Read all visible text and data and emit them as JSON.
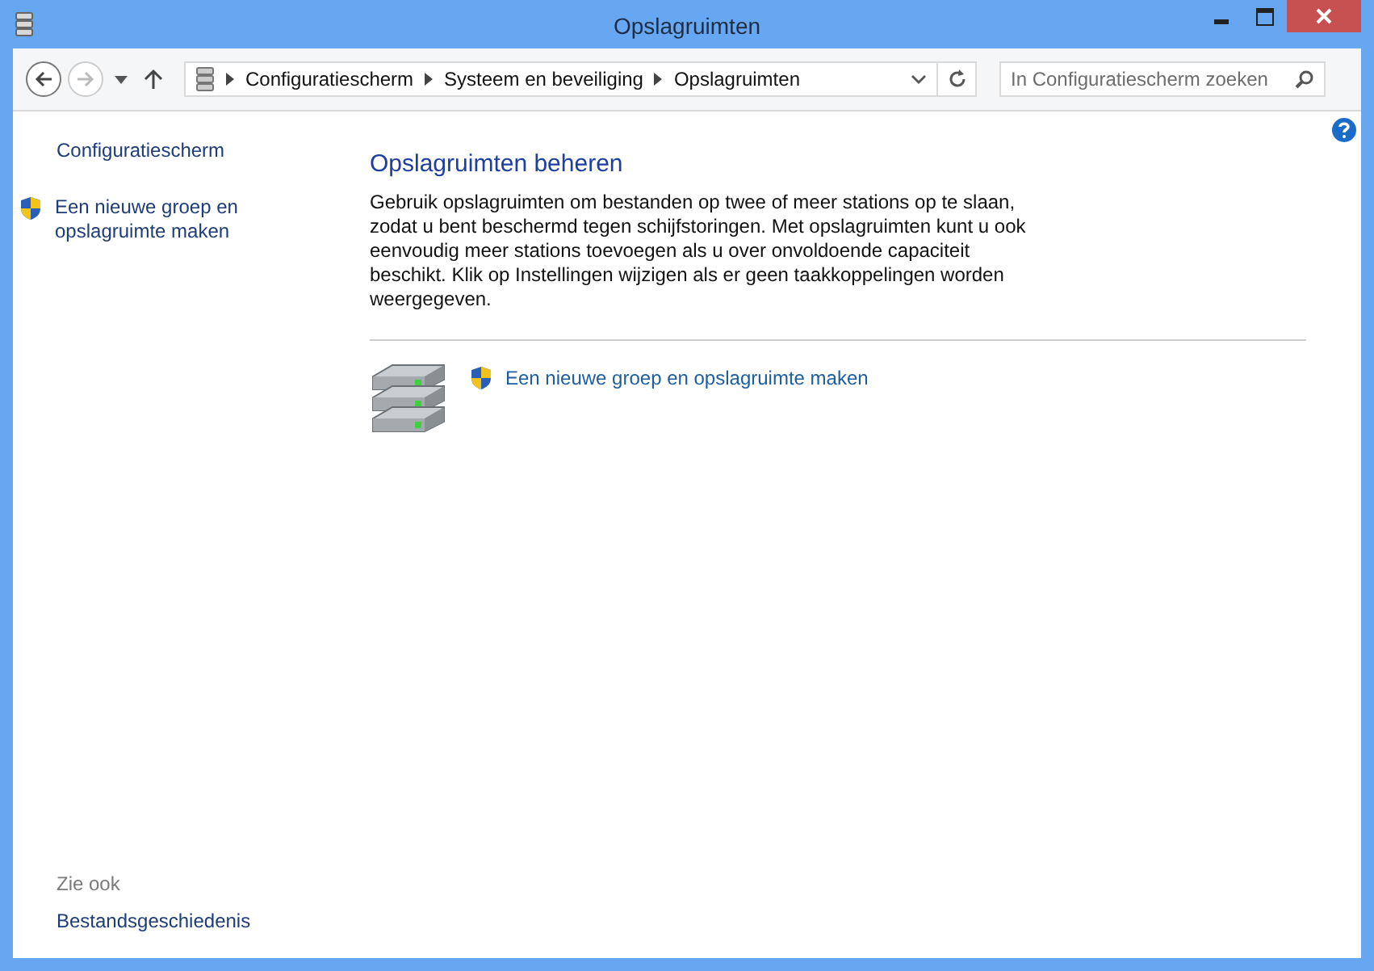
{
  "window": {
    "title": "Opslagruimten"
  },
  "nav_buttons": [
    {
      "kind": "back",
      "disabled": false
    },
    {
      "kind": "forward",
      "disabled": true
    },
    {
      "kind": "recent",
      "disabled": false
    },
    {
      "kind": "up",
      "disabled": false
    }
  ],
  "breadcrumbs": [
    "Configuratiescherm",
    "Systeem en beveiliging",
    "Opslagruimten"
  ],
  "search": {
    "placeholder": "In Configuratiescherm zoeken"
  },
  "sidebar": {
    "items": [
      {
        "label": "Configuratiescherm",
        "shield": false
      },
      {
        "label": "Een nieuwe groep en opslagruimte maken",
        "shield": true
      }
    ],
    "see_also_title": "Zie ook",
    "see_also": [
      "Bestandsgeschiedenis"
    ]
  },
  "main": {
    "heading": "Opslagruimten beheren",
    "description": "Gebruik opslagruimten om bestanden op twee of meer stations op te slaan, zodat u bent beschermd tegen schijfstoringen. Met opslagruimten kunt u ook eenvoudig meer stations toevoegen als u over onvoldoende capaciteit beschikt. Klik op Instellingen wijzigen als er geen taakkoppelingen worden weergegeven.",
    "task_link": "Een nieuwe groep en opslagruimte maken"
  }
}
